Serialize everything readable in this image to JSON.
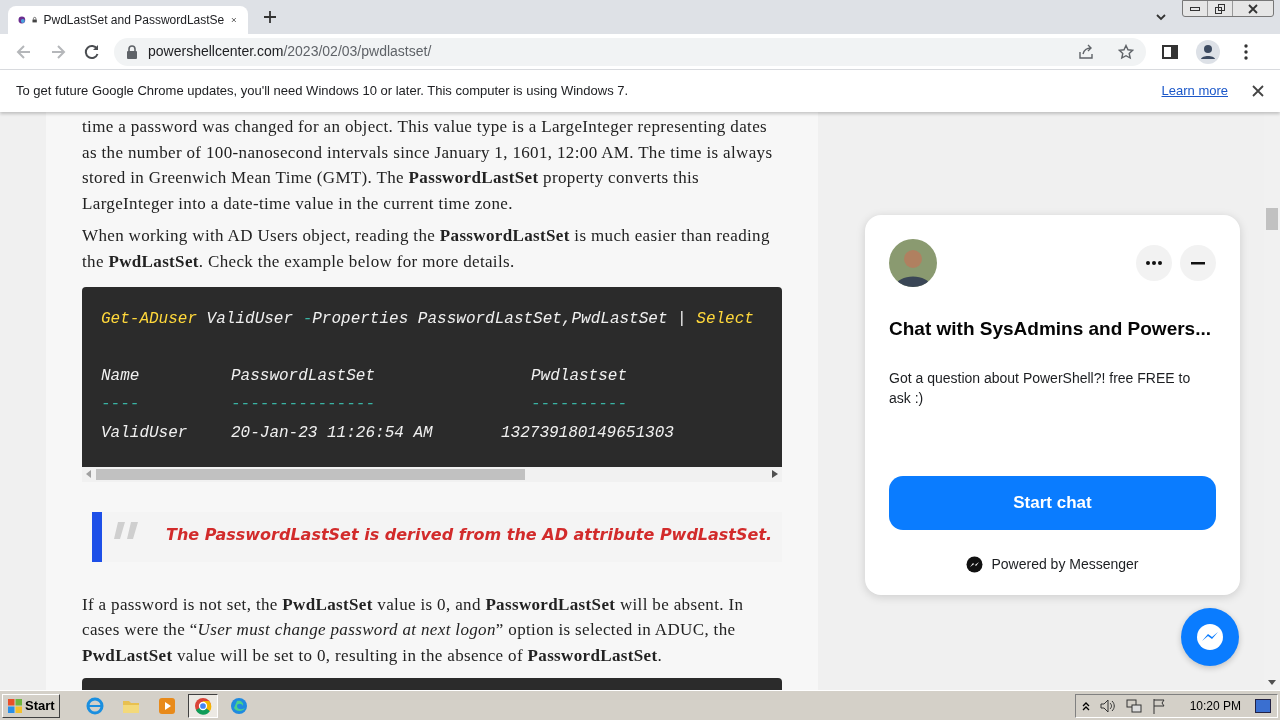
{
  "browser": {
    "tabs": [
      {
        "title": "PwdLastSet and PasswordLastSe",
        "selected": true
      }
    ],
    "nav": [
      {
        "kind": "back",
        "disabled": true
      },
      {
        "kind": "forward",
        "disabled": true
      },
      {
        "kind": "reload",
        "disabled": false
      }
    ],
    "address": {
      "domain": "powershellcenter.com",
      "path": "/2023/02/03/pwdlastset/"
    }
  },
  "infobar": {
    "message": "To get future Google Chrome updates, you'll need Windows 10 or later. This computer is using Windows 7.",
    "link": "Learn more"
  },
  "article": {
    "blocks": [
      {
        "kind": "paragraph",
        "text": "time a password was changed for an object. This value type is a LargeInteger representing dates as the number of 100-nanosecond intervals since January 1, 1601, 12:00 AM. The time is always stored in Greenwich Mean Time (GMT). The **PasswordLastSet** property converts this LargeInteger into a date-time value in the current time zone."
      },
      {
        "kind": "paragraph",
        "text": "When working with AD Users object, reading the **PasswordLastSet** is much easier than reading the **PwdLastSet**. Check the example below for more details."
      },
      {
        "kind": "code",
        "command": [
          {
            "kind": "cmdlet",
            "text": "Get-ADuser"
          },
          {
            "kind": "text",
            "text": " ValidUser "
          },
          {
            "kind": "operator",
            "text": "-"
          },
          {
            "kind": "text",
            "text": "Properties PasswordLastSet,PwdLastSet | "
          },
          {
            "kind": "cmdlet",
            "text": "Select"
          }
        ],
        "columns": [
          "Name",
          "PasswordLastSet",
          "Pwdlastset"
        ],
        "underlines": [
          "----",
          "---------------",
          "----------"
        ],
        "row": [
          "ValidUser",
          "20-Jan-23 11:26:54 AM",
          "132739180149651303"
        ]
      },
      {
        "kind": "quote",
        "text": "The **PasswordLastSet** is derived from the AD attribute **PwdLastSet**."
      },
      {
        "kind": "paragraph",
        "text": "If a password is not set, the **PwdLastSet** value is 0, and **PasswordLastSet** will be absent. In cases were the “*User must change password at next logon*” option is selected in ADUC, the **PwdLastSet** value will be set to 0, resulting in the absence of **PasswordLastSet**."
      },
      {
        "kind": "code_cut"
      }
    ]
  },
  "chat": {
    "title": "Chat with SysAdmins and Powers...",
    "message": "Got a question about PowerShell?! free FREE to ask :)",
    "button": "Start chat",
    "footer": "Powered by Messenger"
  },
  "taskbar": {
    "start": "Start",
    "items": [
      {
        "kind": "ie",
        "selected": false
      },
      {
        "kind": "folder",
        "selected": false
      },
      {
        "kind": "media",
        "selected": false
      },
      {
        "kind": "chrome",
        "selected": true
      },
      {
        "kind": "edge",
        "selected": false
      }
    ],
    "time": "10:20 PM"
  }
}
